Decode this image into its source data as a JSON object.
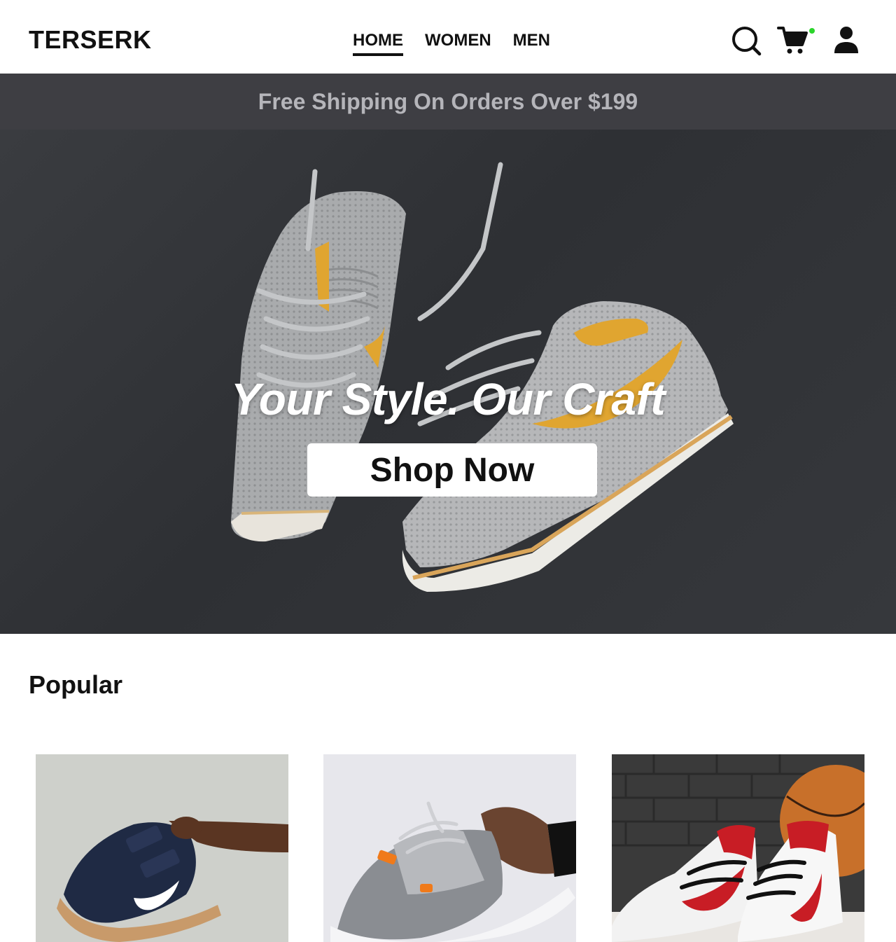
{
  "header": {
    "logo": "TERSERK",
    "nav": [
      {
        "label": "HOME",
        "active": true
      },
      {
        "label": "WOMEN",
        "active": false
      },
      {
        "label": "MEN",
        "active": false
      }
    ],
    "icons": [
      "search-icon",
      "cart-icon",
      "user-icon"
    ],
    "cart_indicator_color": "#2bd52b"
  },
  "promo": {
    "text": "Free Shipping On Orders Over $199"
  },
  "hero": {
    "title": "Your Style. Our Craft",
    "cta_label": "Shop Now"
  },
  "popular": {
    "title": "Popular",
    "products": [
      {
        "image": "navy-sneaker-gum-sole"
      },
      {
        "image": "grey-white-high-top-sneaker"
      },
      {
        "image": "white-red-high-top-sneaker"
      }
    ]
  },
  "colors": {
    "promo_bg": "#3e3e43",
    "promo_text": "#b5b5ba",
    "hero_bg": "#303236",
    "accent_gold": "#e0a530"
  }
}
